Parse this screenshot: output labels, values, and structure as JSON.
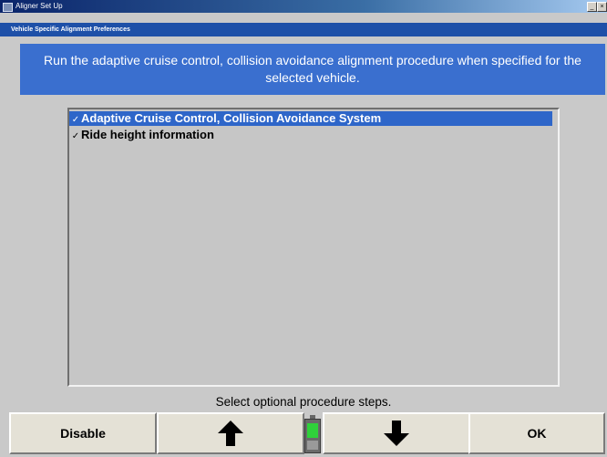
{
  "window": {
    "title": "Aligner Set Up",
    "minimize_glyph": "_",
    "close_glyph": "×"
  },
  "subtitle": "Vehicle Specific Alignment Preferences",
  "instruction": "Run the adaptive cruise control, collision avoidance alignment procedure when specified for the selected vehicle.",
  "list": {
    "items": [
      {
        "label": "Adaptive Cruise Control, Collision Avoidance System",
        "checked": true,
        "selected": true,
        "check_glyph": "✓"
      },
      {
        "label": "Ride height information",
        "checked": true,
        "selected": false,
        "check_glyph": "✓"
      }
    ]
  },
  "status": "Select optional procedure steps.",
  "toolbar": {
    "disable_label": "Disable",
    "up_icon": "arrow-up-icon",
    "indicator_icon": "level-indicator-icon",
    "down_icon": "arrow-down-icon",
    "ok_label": "OK"
  },
  "colors": {
    "title_bar": "#0a246a",
    "banner": "#3a6fcf",
    "selection": "#2e66c9",
    "panel": "#c9c9c9",
    "indicator": "#2fd13a"
  }
}
